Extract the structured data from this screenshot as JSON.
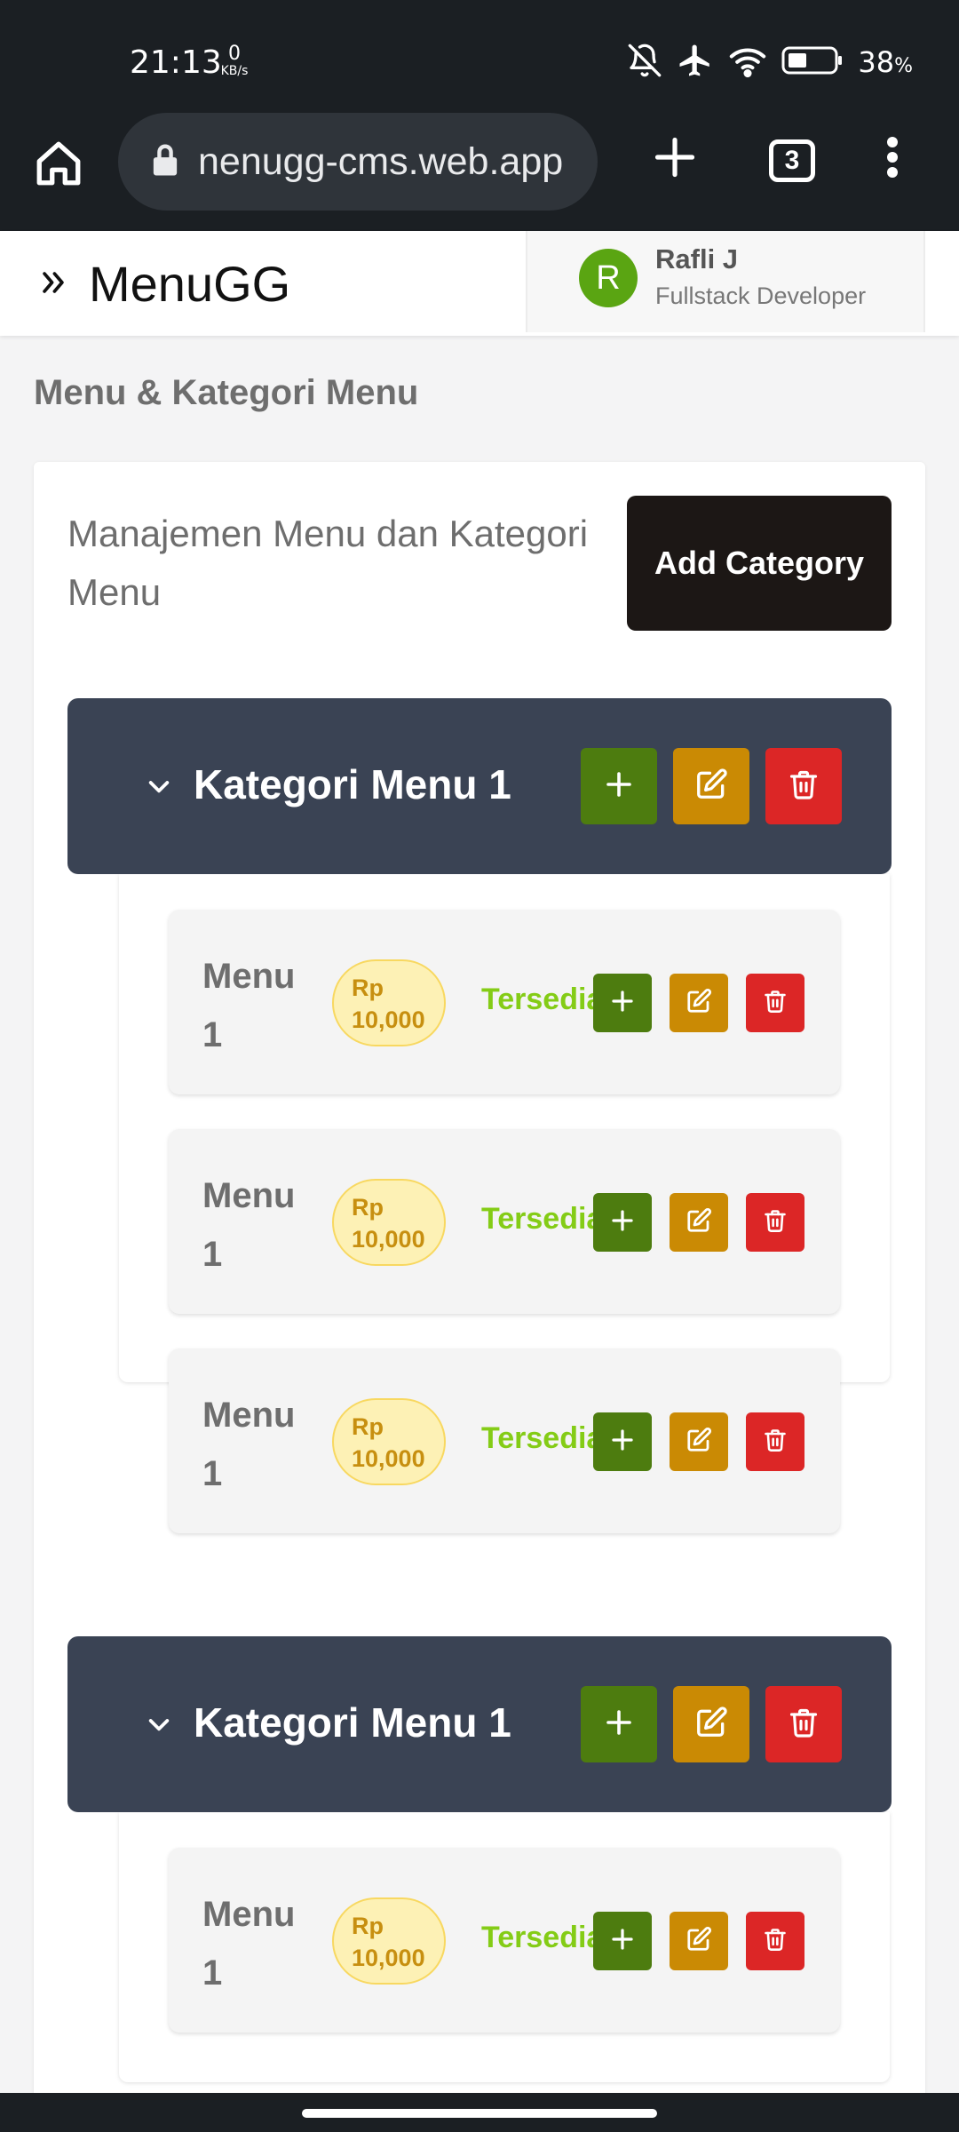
{
  "status_bar": {
    "time": "21:13",
    "net_speed_value": "0",
    "net_speed_unit": "KB/s",
    "battery_percent": "38",
    "battery_percent_symbol": "%",
    "icons": [
      "bell-off-icon",
      "airplane-icon",
      "wifi-icon",
      "battery-icon"
    ]
  },
  "browser": {
    "url": "nenugg-cms.web.app",
    "tab_count": "3"
  },
  "header": {
    "brand": "MenuGG",
    "user": {
      "initial": "R",
      "name": "Rafli J",
      "role": "Fullstack Developer",
      "avatar_color": "#5aa512"
    }
  },
  "page": {
    "title": "Menu & Kategori Menu",
    "card_title": "Manajemen Menu dan Kategori Menu",
    "add_category_label": "Add Category"
  },
  "colors": {
    "category_header": "#3a4354",
    "add_button": "#4d7c0f",
    "edit_button": "#ca8a04",
    "delete_button": "#dc2626",
    "status_available": "#84cc16",
    "price_badge_bg": "#fdf1b5",
    "price_badge_text": "#c78f10"
  },
  "categories": [
    {
      "name": "Kategori Menu 1",
      "items": [
        {
          "name": "Menu 1",
          "price_currency": "Rp",
          "price_value": "10,000",
          "status": "Tersedia"
        },
        {
          "name": "Menu 1",
          "price_currency": "Rp",
          "price_value": "10,000",
          "status": "Tersedia"
        },
        {
          "name": "Menu 1",
          "price_currency": "Rp",
          "price_value": "10,000",
          "status": "Tersedia"
        }
      ]
    },
    {
      "name": "Kategori Menu 1",
      "items": [
        {
          "name": "Menu 1",
          "price_currency": "Rp",
          "price_value": "10,000",
          "status": "Tersedia"
        }
      ]
    }
  ]
}
